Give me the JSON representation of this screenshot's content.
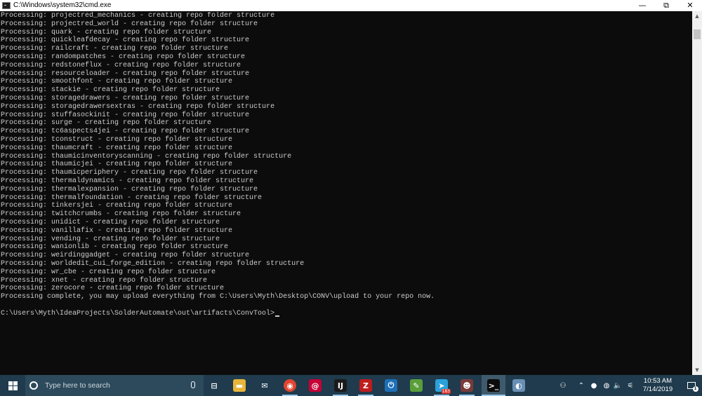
{
  "window": {
    "title": "C:\\Windows\\system32\\cmd.exe",
    "minimize_glyph": "—",
    "maximize_glyph": "⧉",
    "close_glyph": "✕"
  },
  "console": {
    "lines": [
      "Processing: projectred_mechanics - creating repo folder structure",
      "Processing: projectred_world - creating repo folder structure",
      "Processing: quark - creating repo folder structure",
      "Processing: quickleafdecay - creating repo folder structure",
      "Processing: railcraft - creating repo folder structure",
      "Processing: randompatches - creating repo folder structure",
      "Processing: redstoneflux - creating repo folder structure",
      "Processing: resourceloader - creating repo folder structure",
      "Processing: smoothfont - creating repo folder structure",
      "Processing: stackie - creating repo folder structure",
      "Processing: storagedrawers - creating repo folder structure",
      "Processing: storagedrawersextras - creating repo folder structure",
      "Processing: stuffasockinit - creating repo folder structure",
      "Processing: surge - creating repo folder structure",
      "Processing: tc6aspects4jei - creating repo folder structure",
      "Processing: tconstruct - creating repo folder structure",
      "Processing: thaumcraft - creating repo folder structure",
      "Processing: thaumicinventoryscanning - creating repo folder structure",
      "Processing: thaumicjei - creating repo folder structure",
      "Processing: thaumicperiphery - creating repo folder structure",
      "Processing: thermaldynamics - creating repo folder structure",
      "Processing: thermalexpansion - creating repo folder structure",
      "Processing: thermalfoundation - creating repo folder structure",
      "Processing: tinkersjei - creating repo folder structure",
      "Processing: twitchcrumbs - creating repo folder structure",
      "Processing: unidict - creating repo folder structure",
      "Processing: vanillafix - creating repo folder structure",
      "Processing: vending - creating repo folder structure",
      "Processing: wanionlib - creating repo folder structure",
      "Processing: weirdinggadget - creating repo folder structure",
      "Processing: worldedit_cui_forge_edition - creating repo folder structure",
      "Processing: wr_cbe - creating repo folder structure",
      "Processing: xnet - creating repo folder structure",
      "Processing: zerocore - creating repo folder structure",
      "Processing complete, you may upload everything from C:\\Users\\Myth\\Desktop\\CONV\\upload to your repo now.",
      ""
    ],
    "prompt": "C:\\Users\\Myth\\IdeaProjects\\SolderAutomate\\out\\artifacts\\ConvTool>"
  },
  "taskbar": {
    "search_placeholder": "Type here to search",
    "apps": [
      {
        "name": "task-view-icon",
        "glyph": "⊟",
        "bg": "transparent"
      },
      {
        "name": "file-explorer-icon",
        "glyph": "▬",
        "bg": "#e8b53a"
      },
      {
        "name": "mail-icon",
        "glyph": "✉",
        "bg": "transparent"
      },
      {
        "name": "chrome-icon",
        "glyph": "◉",
        "bg": "#e0452f"
      },
      {
        "name": "debian-icon",
        "glyph": "@",
        "bg": "#c70036"
      },
      {
        "name": "intellij-icon",
        "glyph": "IJ",
        "bg": "#1b1b1b"
      },
      {
        "name": "filezilla-icon",
        "glyph": "Z",
        "bg": "#bf1c1c"
      },
      {
        "name": "power-icon",
        "glyph": "⏻",
        "bg": "#1d6fb8"
      },
      {
        "name": "notepad-icon",
        "glyph": "✎",
        "bg": "#5a9e3a"
      },
      {
        "name": "telegram-icon",
        "glyph": "➤",
        "bg": "#2aa1da"
      },
      {
        "name": "game-icon",
        "glyph": "☻",
        "bg": "#7a3a3a"
      },
      {
        "name": "cmd-icon",
        "glyph": ">_",
        "bg": "#0c0c0c"
      },
      {
        "name": "paint-icon",
        "glyph": "◐",
        "bg": "#6a8fb5"
      }
    ],
    "telegram_badge": "183",
    "tray": [
      {
        "name": "people-icon",
        "glyph": "⚇"
      },
      {
        "name": "show-hidden-icons-icon",
        "glyph": "⌃"
      },
      {
        "name": "tray-app-icon",
        "glyph": "●"
      },
      {
        "name": "discord-icon",
        "glyph": "◍"
      },
      {
        "name": "volume-icon",
        "glyph": "🔈"
      },
      {
        "name": "network-icon",
        "glyph": "⚟"
      },
      {
        "name": "keyboard-icon",
        "glyph": "⌨"
      }
    ],
    "time": "10:53 AM",
    "date": "7/14/2019",
    "notification_count": "1"
  }
}
